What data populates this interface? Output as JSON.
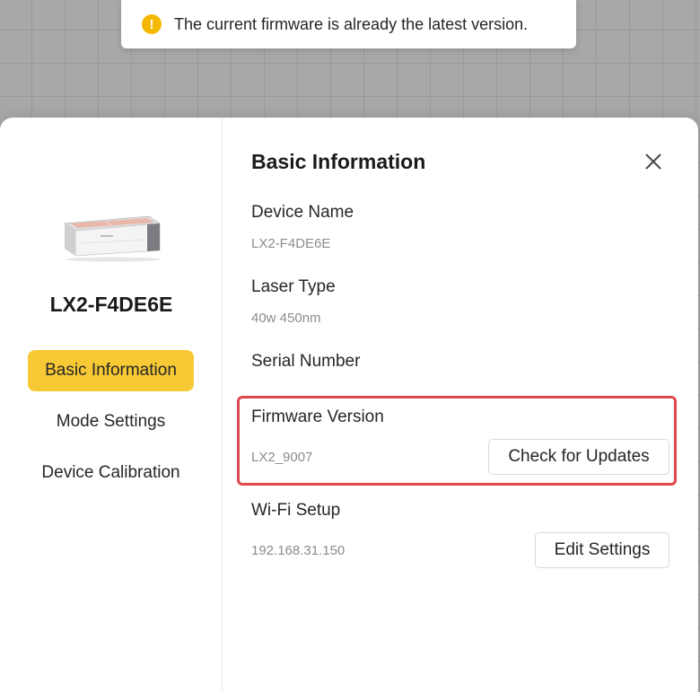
{
  "toast": {
    "icon": "warning-icon",
    "icon_glyph": "!",
    "message": "The current firmware is already the latest version.",
    "icon_color": "#f5b800"
  },
  "sidebar": {
    "device_image": "laser-engraver-device-image",
    "device_name": "LX2-F4DE6E",
    "items": [
      {
        "label": "Basic Information",
        "active": true
      },
      {
        "label": "Mode Settings",
        "active": false
      },
      {
        "label": "Device Calibration",
        "active": false
      }
    ],
    "active_color": "#f7c935"
  },
  "main": {
    "title": "Basic Information",
    "close_icon": "close-icon",
    "fields": {
      "device_name": {
        "label": "Device Name",
        "value": "LX2-F4DE6E"
      },
      "laser_type": {
        "label": "Laser Type",
        "value": "40w 450nm"
      },
      "serial_number": {
        "label": "Serial Number",
        "value": ""
      },
      "firmware_version": {
        "label": "Firmware Version",
        "value": "LX2_9007",
        "action": "Check for Updates"
      },
      "wifi_setup": {
        "label": "Wi-Fi Setup",
        "value": "192.168.31.150",
        "action": "Edit Settings"
      }
    },
    "highlight_color": "#e0474c"
  }
}
